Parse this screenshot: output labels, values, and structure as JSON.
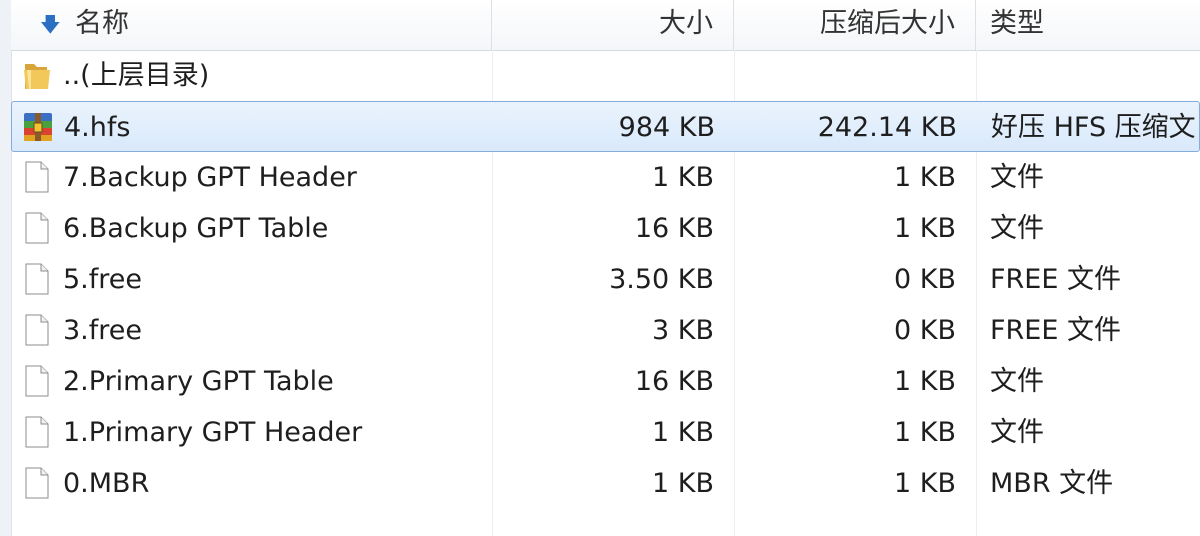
{
  "columns": {
    "name": "名称",
    "size": "大小",
    "compressed_size": "压缩后大小",
    "type": "类型"
  },
  "rows": [
    {
      "name": "..(上层目录)",
      "size": "",
      "compressed": "",
      "type": "",
      "icon": "folder-icon"
    },
    {
      "name": "4.hfs",
      "size": "984 KB",
      "compressed": "242.14 KB",
      "type": "好压 HFS 压缩文",
      "icon": "archive-icon",
      "selected": true
    },
    {
      "name": "7.Backup GPT Header",
      "size": "1 KB",
      "compressed": "1 KB",
      "type": "文件",
      "icon": "file-icon"
    },
    {
      "name": "6.Backup GPT Table",
      "size": "16 KB",
      "compressed": "1 KB",
      "type": "文件",
      "icon": "file-icon"
    },
    {
      "name": "5.free",
      "size": "3.50 KB",
      "compressed": "0 KB",
      "type": "FREE 文件",
      "icon": "file-icon"
    },
    {
      "name": "3.free",
      "size": "3 KB",
      "compressed": "0 KB",
      "type": "FREE 文件",
      "icon": "file-icon"
    },
    {
      "name": "2.Primary GPT Table",
      "size": "16 KB",
      "compressed": "1 KB",
      "type": "文件",
      "icon": "file-icon"
    },
    {
      "name": "1.Primary GPT Header",
      "size": "1 KB",
      "compressed": "1 KB",
      "type": "文件",
      "icon": "file-icon"
    },
    {
      "name": "0.MBR",
      "size": "1 KB",
      "compressed": "1 KB",
      "type": "MBR 文件",
      "icon": "file-icon"
    }
  ],
  "colors": {
    "selection_border": "#84acdd",
    "selection_bg": "#d9e9fb",
    "folder": "#e8b84a",
    "sort_arrow": "#2a6fc2"
  }
}
